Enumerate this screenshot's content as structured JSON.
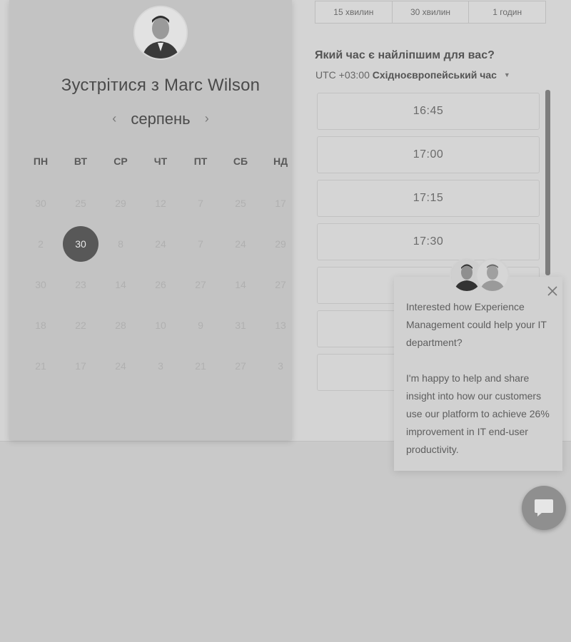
{
  "scheduler": {
    "title_prefix": "Зустрітися з",
    "host_name": "Marc Wilson",
    "month": "серпень",
    "prev_icon": "‹",
    "next_icon": "›",
    "weekdays": [
      "ПН",
      "ВТ",
      "СР",
      "ЧТ",
      "ПТ",
      "СБ",
      "НД"
    ],
    "weeks": [
      [
        "30",
        "25",
        "29",
        "12",
        "7",
        "25",
        "17"
      ],
      [
        "2",
        "30",
        "8",
        "24",
        "7",
        "24",
        "29"
      ],
      [
        "30",
        "23",
        "14",
        "26",
        "27",
        "14",
        "27"
      ],
      [
        "18",
        "22",
        "28",
        "10",
        "9",
        "31",
        "13"
      ],
      [
        "21",
        "17",
        "24",
        "3",
        "21",
        "27",
        "3"
      ]
    ],
    "selected_day": "30"
  },
  "durations": [
    "15 хвилин",
    "30 хвилин",
    "1 годин"
  ],
  "time_question": "Який час є найліпшим для вас?",
  "timezone": {
    "offset": "UTC +03:00",
    "name": "Східноєвропейський час",
    "icon": "caret-down-icon"
  },
  "slots": [
    "16:45",
    "17:00",
    "17:15",
    "17:30",
    "",
    "",
    ""
  ],
  "chat": {
    "paragraph1": "Interested how Experience Management could help your IT department?",
    "paragraph2": "I'm happy to help and share insight into how our customers use our platform to achieve 26% improvement in IT end-user productivity.",
    "close_icon": "close-icon",
    "launcher_icon": "chat-bubble-icon"
  },
  "colors": {
    "selected_day_bg": "#585858",
    "overlay_tint": "#c9c9c9"
  }
}
